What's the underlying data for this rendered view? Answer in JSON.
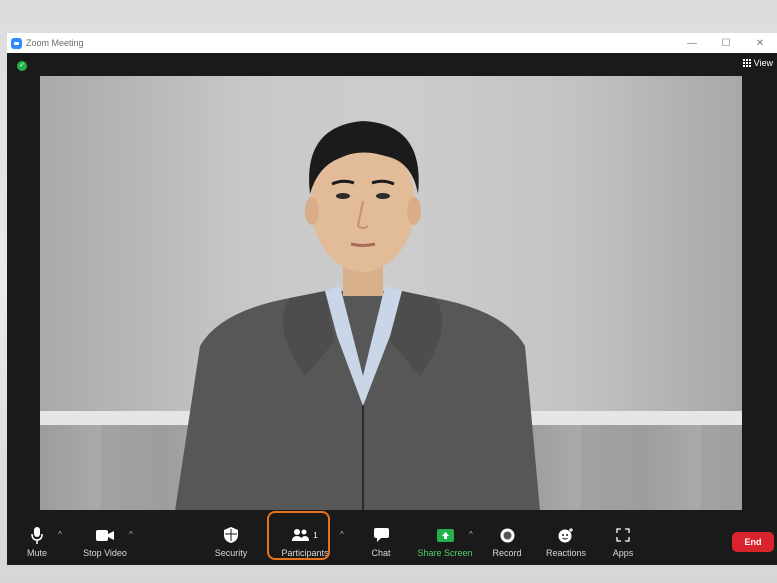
{
  "window": {
    "title": "Zoom Meeting"
  },
  "header": {
    "view_label": "View"
  },
  "toolbar": {
    "mute": "Mute",
    "stop_video": "Stop Video",
    "security": "Security",
    "participants": "Participants",
    "participants_count": "1",
    "chat": "Chat",
    "share_screen": "Share Screen",
    "record": "Record",
    "reactions": "Reactions",
    "apps": "Apps",
    "end": "End"
  },
  "colors": {
    "highlight": "#e8731a",
    "share_screen_accent": "#22b14c",
    "end_button": "#d9232d",
    "encryption_shield": "#22b14c"
  }
}
